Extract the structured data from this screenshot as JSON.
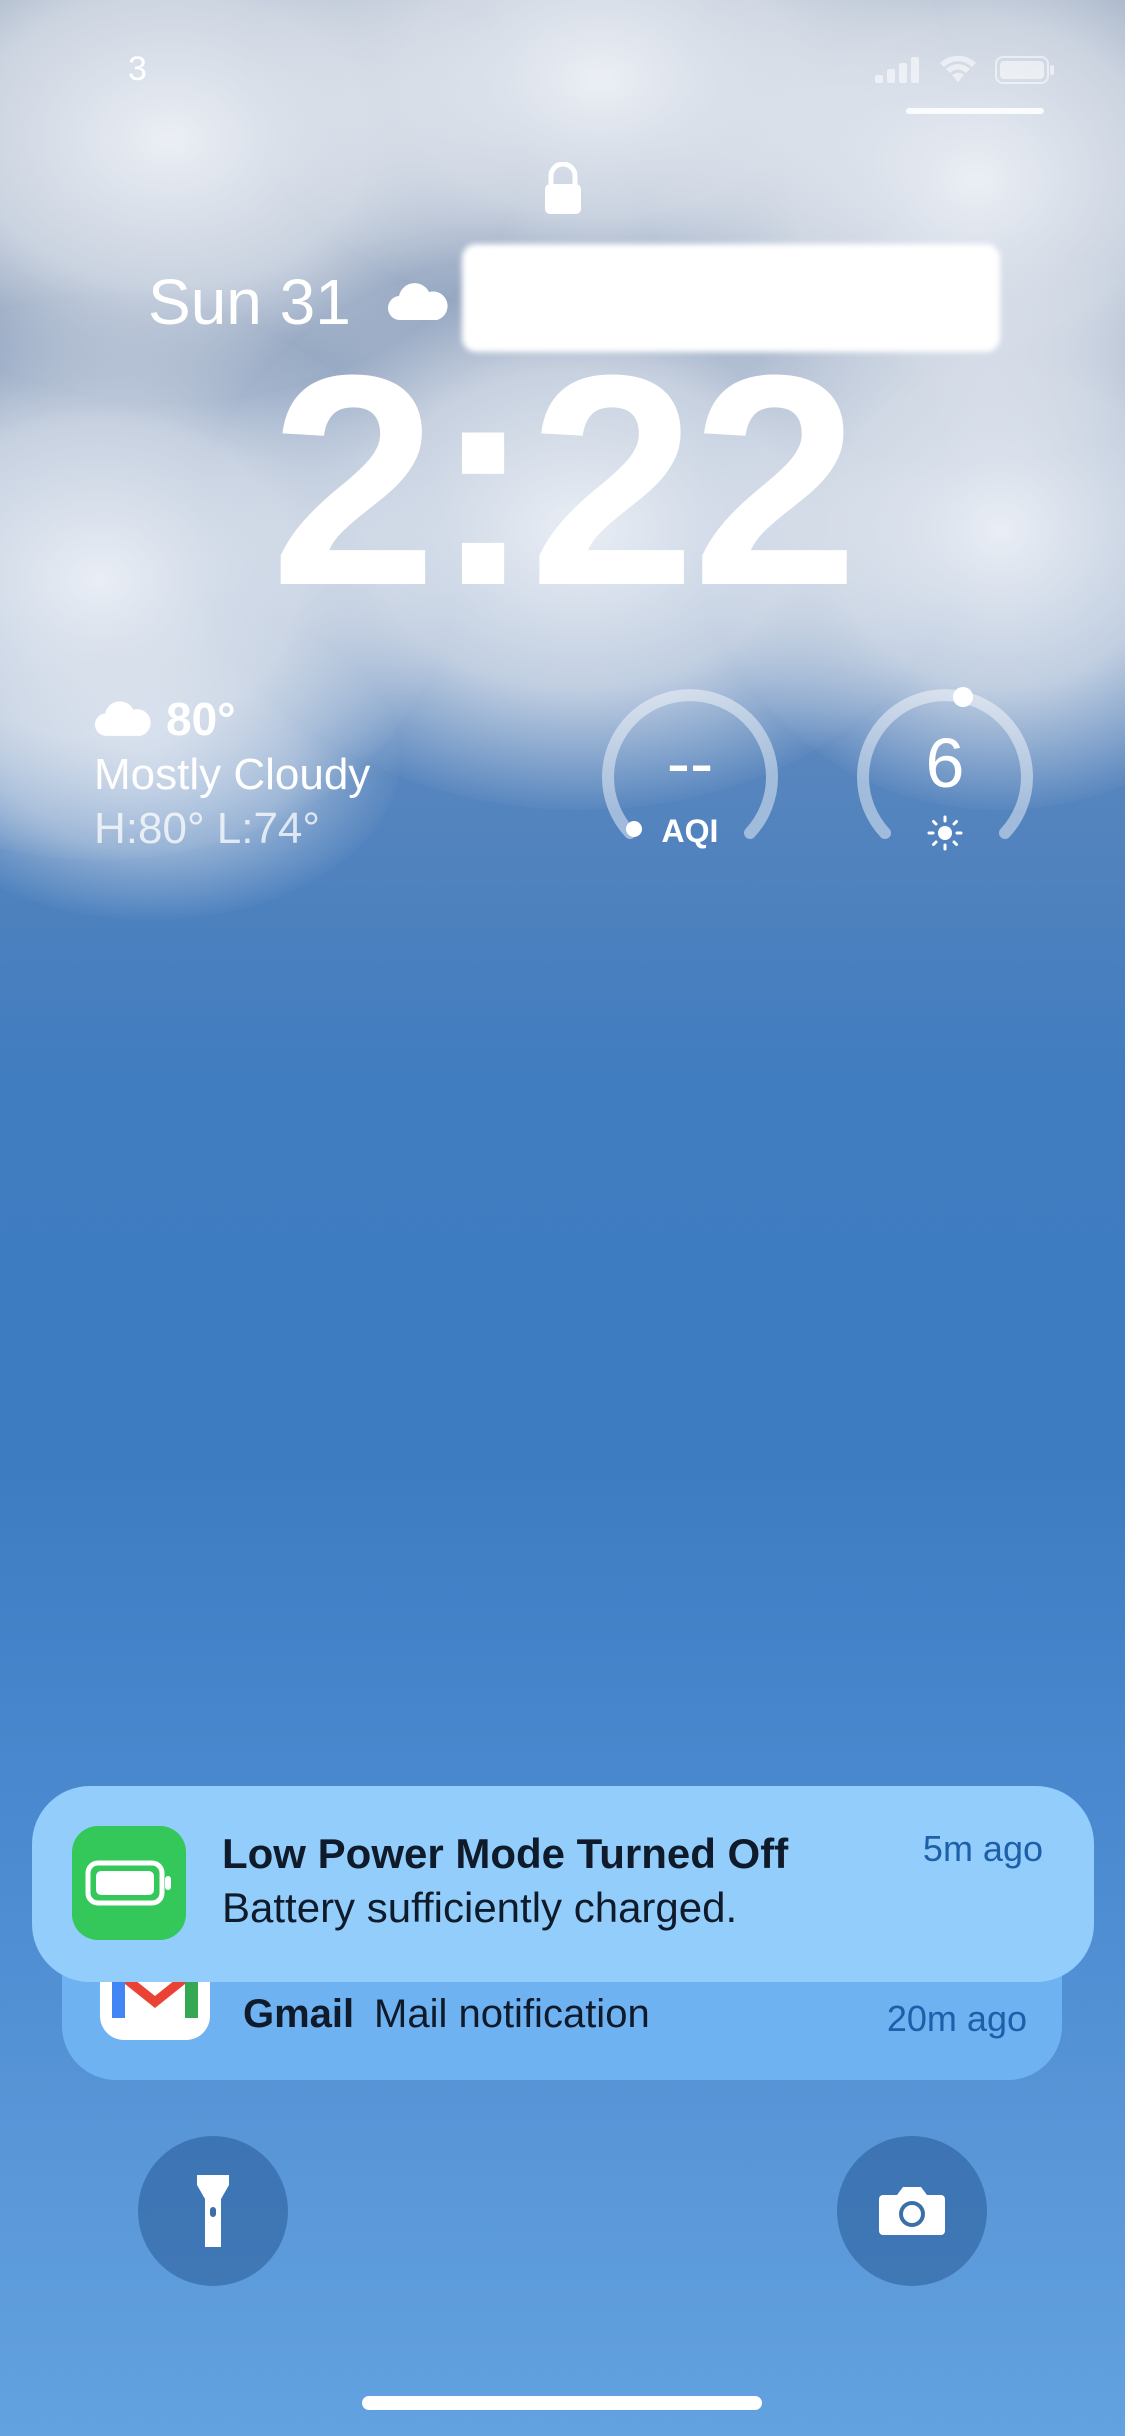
{
  "status_bar": {
    "left_text": "3"
  },
  "lock_screen": {
    "date": "Sun 31",
    "time": "2:22"
  },
  "weather": {
    "temperature": "80°",
    "condition": "Mostly Cloudy",
    "high_low": "H:80° L:74°",
    "icon": "cloud-icon"
  },
  "widgets": {
    "aqi": {
      "value": "--",
      "label": "AQI"
    },
    "uv": {
      "value": "6",
      "icon": "sun-icon"
    }
  },
  "notifications": [
    {
      "app_icon": "battery-icon",
      "title": "Low Power Mode Turned Off",
      "body": "Battery sufficiently charged.",
      "time": "5m ago",
      "color": "#34c759"
    },
    {
      "app_icon": "gmail-icon",
      "app": "Gmail",
      "body": "Mail notification",
      "time": "20m ago"
    }
  ],
  "controls": {
    "left": "flashlight-icon",
    "right": "camera-icon"
  }
}
